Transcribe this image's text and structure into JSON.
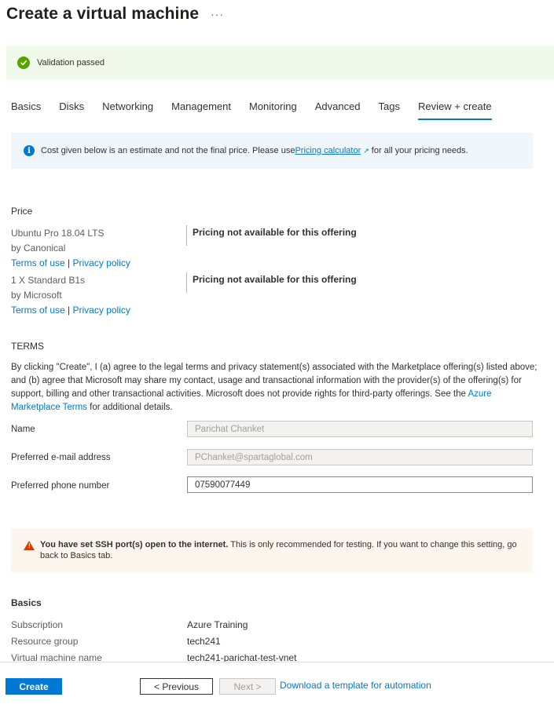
{
  "page": {
    "title": "Create a virtual machine",
    "more": "···"
  },
  "validation": {
    "text": "Validation passed",
    "color": "#57a300"
  },
  "tabs": [
    {
      "label": "Basics"
    },
    {
      "label": "Disks"
    },
    {
      "label": "Networking"
    },
    {
      "label": "Management"
    },
    {
      "label": "Monitoring"
    },
    {
      "label": "Advanced"
    },
    {
      "label": "Tags"
    },
    {
      "label": "Review + create",
      "active": true
    }
  ],
  "info": {
    "text_before": "Cost given below is an estimate and not the final price. Please use ",
    "link": "Pricing calculator",
    "text_after": " for all your pricing needs."
  },
  "price": {
    "heading": "Price",
    "items": [
      {
        "product": "Ubuntu Pro 18.04 LTS",
        "by": "by Canonical",
        "terms": "Terms of use",
        "separator": "|",
        "privacy": "Privacy policy",
        "pricing": "Pricing not available for this offering"
      },
      {
        "product": "1 X Standard B1s",
        "by": "by Microsoft",
        "terms": "Terms of use",
        "separator": "|",
        "privacy": "Privacy policy",
        "pricing": "Pricing not available for this offering"
      }
    ]
  },
  "terms": {
    "heading": "TERMS",
    "text_before": "By clicking \"Create\", I (a) agree to the legal terms and privacy statement(s) associated with the Marketplace offering(s) listed above; and (b) agree that Microsoft may share my contact, usage and transactional information with the provider(s) of the offering(s) for support, billing and other transactional activities. Microsoft does not provide rights for third-party offerings. See the ",
    "link": "Azure Marketplace Terms",
    "text_after": " for additional details."
  },
  "form": {
    "name_label": "Name",
    "name_value": "Parichat Chanket",
    "email_label": "Preferred e-mail address",
    "email_value": "PChanket@spartaglobal.com",
    "phone_label": "Preferred phone number",
    "phone_value": "07590077449"
  },
  "warning": {
    "bold": "You have set SSH port(s) open to the internet.",
    "text": "  This is only recommended for testing.  If you want to change this setting, go back to Basics tab.",
    "color": "#d83b01"
  },
  "basics": {
    "heading": "Basics",
    "rows": [
      {
        "label": "Subscription",
        "value": "Azure Training"
      },
      {
        "label": "Resource group",
        "value": "tech241"
      },
      {
        "label": "Virtual machine name",
        "value": "tech241-parichat-test-vnet"
      }
    ]
  },
  "footer": {
    "create": "Create",
    "previous": "< Previous",
    "next": "Next >",
    "download": "Download a template for automation",
    "accent": "#0078d4"
  }
}
